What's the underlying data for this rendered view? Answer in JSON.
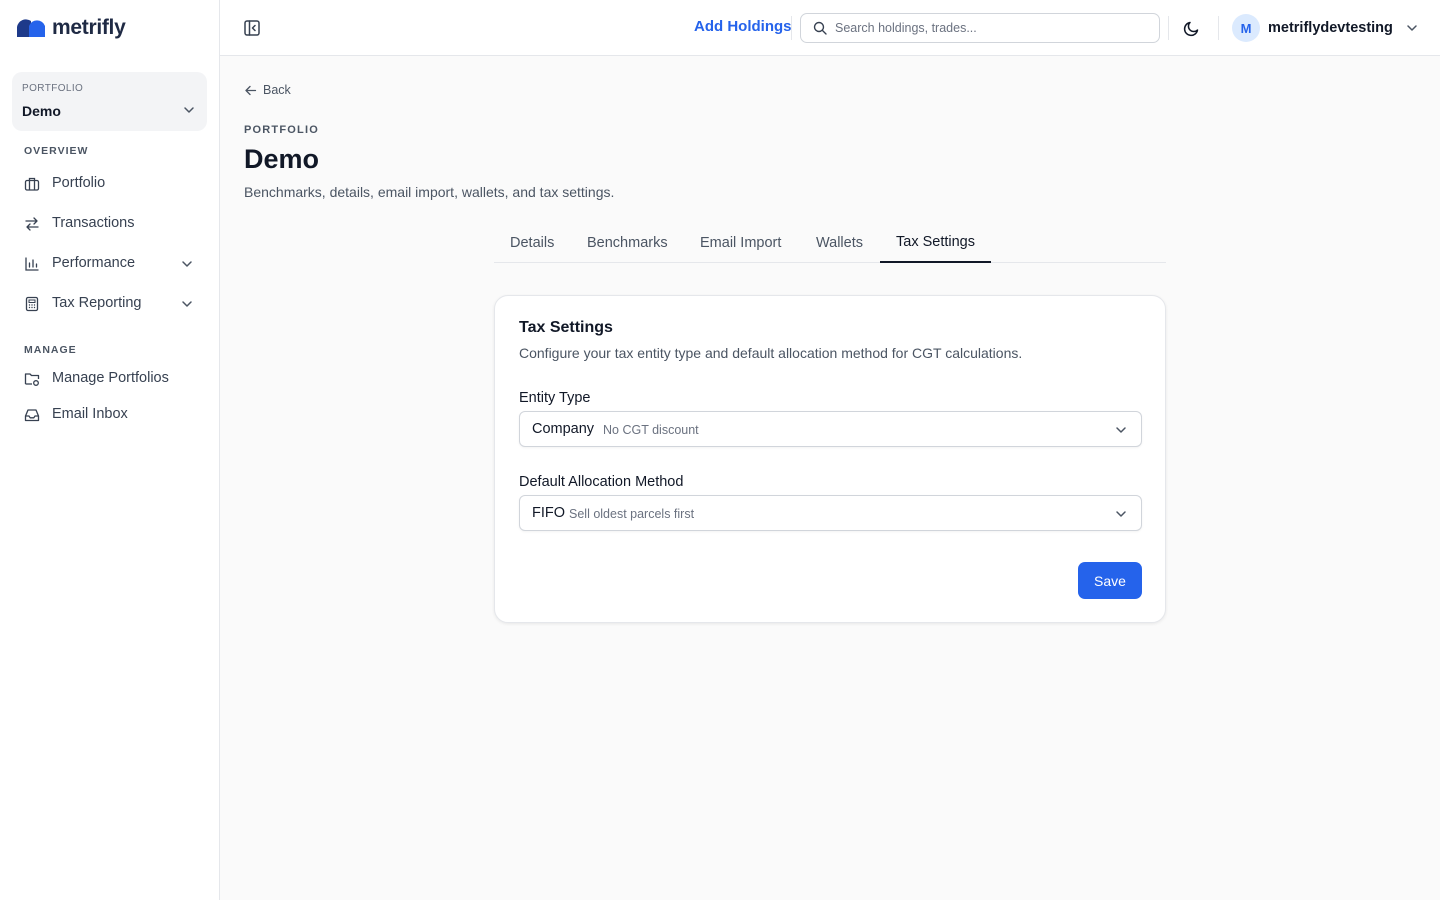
{
  "brand": {
    "name": "metrifly",
    "logo_icon": "metrifly-logo-icon"
  },
  "sidebar": {
    "portfolio_picker": {
      "label": "PORTFOLIO",
      "value": "Demo"
    },
    "sections": [
      {
        "label": "OVERVIEW",
        "items": [
          {
            "label": "Portfolio",
            "icon": "briefcase-icon"
          },
          {
            "label": "Transactions",
            "icon": "arrows-exchange-icon"
          },
          {
            "label": "Performance",
            "icon": "bar-chart-icon",
            "expandable": true
          },
          {
            "label": "Tax Reporting",
            "icon": "calculator-icon",
            "expandable": true
          }
        ]
      },
      {
        "label": "MANAGE",
        "items": [
          {
            "label": "Manage Portfolios",
            "icon": "folder-cog-icon"
          },
          {
            "label": "Email Inbox",
            "icon": "inbox-icon"
          }
        ]
      }
    ]
  },
  "header": {
    "add_holdings": "Add Holdings",
    "search_placeholder": "Search holdings, trades...",
    "user": {
      "initial": "M",
      "name": "metriflydevtesting"
    }
  },
  "page": {
    "back": "Back",
    "eyebrow": "PORTFOLIO",
    "title": "Demo",
    "subtitle": "Benchmarks, details, email import, wallets, and tax settings."
  },
  "tabs": [
    {
      "label": "Details"
    },
    {
      "label": "Benchmarks"
    },
    {
      "label": "Email Import"
    },
    {
      "label": "Wallets"
    },
    {
      "label": "Tax Settings",
      "active": true
    }
  ],
  "tax_settings": {
    "title": "Tax Settings",
    "description": "Configure your tax entity type and default allocation method for CGT calculations.",
    "entity_type": {
      "label": "Entity Type",
      "value": "Company",
      "hint": "No CGT discount"
    },
    "allocation_method": {
      "label": "Default Allocation Method",
      "value": "FIFO",
      "hint": "Sell oldest parcels first"
    },
    "save_label": "Save"
  },
  "colors": {
    "accent": "#2563eb",
    "background": "#fafafa",
    "text": "#111827",
    "muted": "#4b5563"
  }
}
